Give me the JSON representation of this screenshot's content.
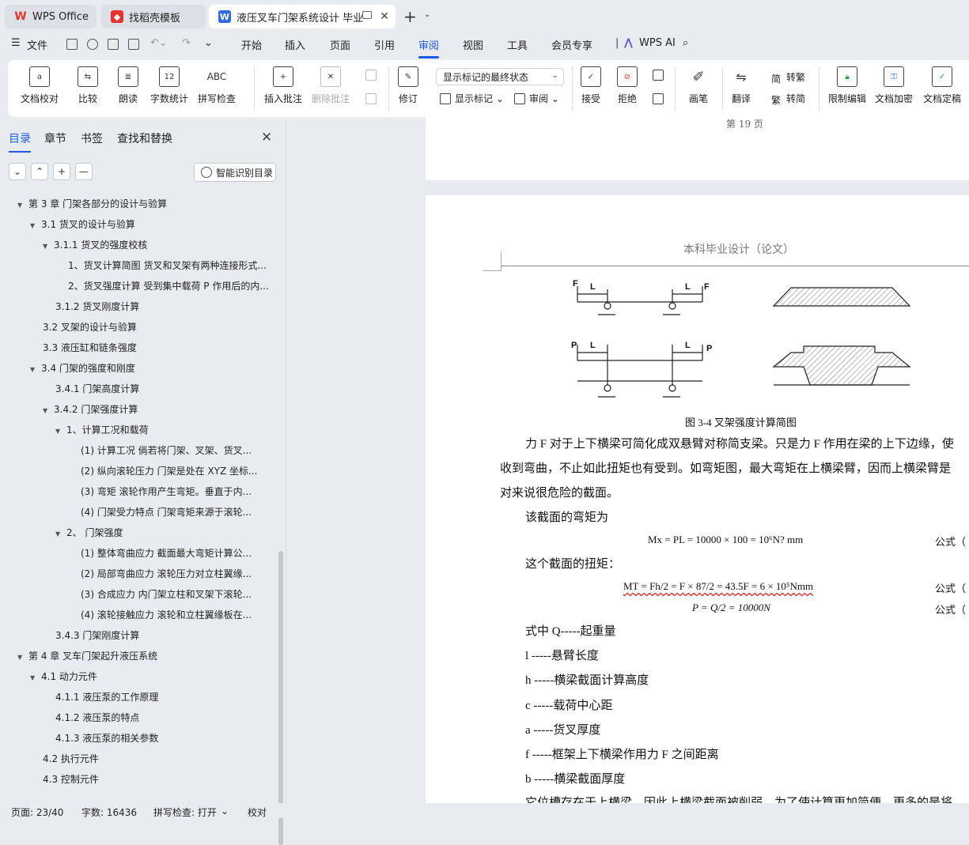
{
  "tabs": [
    {
      "label": "WPS Office",
      "icon": "wps-logo-icon"
    },
    {
      "label": "找稻壳模板",
      "icon": "docer-icon"
    },
    {
      "label": "液压叉车门架系统设计 毕业论",
      "icon": "writer-doc-icon"
    }
  ],
  "menu": {
    "file": "文件",
    "items": [
      "开始",
      "插入",
      "页面",
      "引用",
      "审阅",
      "视图",
      "工具",
      "会员专享"
    ],
    "active": "审阅",
    "ai": "WPS AI"
  },
  "ribbon": {
    "doc_check": "文档校对",
    "compare": "比较",
    "read_aloud": "朗读",
    "word_count": "字数统计",
    "spell_check": "拼写检查",
    "insert_comment": "插入批注",
    "delete_comment": "删除批注",
    "track_changes": "修订",
    "markup_mode": "显示标记的最终状态",
    "show_markup": "显示标记",
    "review_pane": "审阅",
    "accept": "接受",
    "reject": "拒绝",
    "pen": "画笔",
    "translate": "翻译",
    "to_traditional": "转繁",
    "to_simplified": "转简",
    "restrict_edit": "限制编辑",
    "encrypt": "文档加密",
    "finalize": "文档定稿",
    "spell_icon_text": "ABC",
    "count_icon_text": "12"
  },
  "panel": {
    "tabs": [
      "目录",
      "章节",
      "书签",
      "查找和替换"
    ],
    "active_tab": "目录",
    "smart_toc": "智能识别目录",
    "toc": [
      {
        "level": 0,
        "text": "第 3 章  门架各部分的设计与验算",
        "expand": true
      },
      {
        "level": 1,
        "text": "3.1  货叉的设计与验算",
        "expand": true
      },
      {
        "level": 2,
        "text": "3.1.1  货叉的强度校核",
        "expand": true
      },
      {
        "level": 3,
        "text": "1、货叉计算简图  货叉和叉架有两种连接形式..."
      },
      {
        "level": 3,
        "text": "2、货叉强度计算  受到集中载荷 P 作用后的内..."
      },
      {
        "level": 2,
        "text": "3.1.2  货叉刚度计算"
      },
      {
        "level": 1,
        "text": "3.2  叉架的设计与验算"
      },
      {
        "level": 1,
        "text": "3.3  液压缸和链条强度"
      },
      {
        "level": 1,
        "text": "3.4  门架的强度和刚度",
        "expand": true
      },
      {
        "level": 2,
        "text": "3.4.1  门架高度计算"
      },
      {
        "level": 2,
        "text": "3.4.2  门架强度计算",
        "expand": true
      },
      {
        "level": 3,
        "text": "1、计算工况和载荷",
        "expand": true
      },
      {
        "level": 4,
        "text": "(1)   计算工况  倘若将门架、叉架、货叉..."
      },
      {
        "level": 4,
        "text": "(2)   纵向滚轮压力  门架是处在 XYZ 坐标..."
      },
      {
        "level": 4,
        "text": "(3)   弯矩  滚轮作用产生弯矩。垂直于内..."
      },
      {
        "level": 4,
        "text": "(4)   门架受力特点  门架弯矩来源于滚轮..."
      },
      {
        "level": 3,
        "text": "2、   门架强度",
        "expand": true
      },
      {
        "level": 4,
        "text": "(1)   整体弯曲应力  截面最大弯矩计算公..."
      },
      {
        "level": 4,
        "text": "(2)   局部弯曲应力  滚轮压力对立柱翼缘..."
      },
      {
        "level": 4,
        "text": "(3)   合成应力  内门架立柱和叉架下滚轮..."
      },
      {
        "level": 4,
        "text": "(4)   滚轮接触应力  滚轮和立柱翼缘板在..."
      },
      {
        "level": 2,
        "text": "3.4.3  门架刚度计算"
      },
      {
        "level": 0,
        "text": "第 4 章  叉车门架起升液压系统",
        "expand": true
      },
      {
        "level": 1,
        "text": "4.1  动力元件",
        "expand": true
      },
      {
        "level": 2,
        "text": "4.1.1  液压泵的工作原理"
      },
      {
        "level": 2,
        "text": "4.1.2  液压泵的特点"
      },
      {
        "level": 2,
        "text": "4.1.3  液压泵的相关参数"
      },
      {
        "level": 1,
        "text": "4.2  执行元件"
      },
      {
        "level": 1,
        "text": "4.3  控制元件"
      }
    ]
  },
  "document": {
    "page_number": "第 19 页",
    "header": "本科毕业设计（论文）",
    "figure_caption": "图 3-4  叉架强度计算简图",
    "figure_labels": {
      "F": "F",
      "L": "L",
      "P": "P"
    },
    "p1": "力 F 对于上下横梁可简化成双悬臂对称简支梁。只是力 F 作用在梁的上下边缘，使",
    "p2": "收到弯曲，不止如此扭矩也有受到。如弯矩图，最大弯矩在上横梁臂，因而上横梁臂是",
    "p3": "对来说很危险的截面。",
    "p4": "该截面的弯矩为",
    "eq1": "Mx = PL = 10000 × 100 =  10⁶N? mm",
    "eq_label": "公式（",
    "p5": "这个截面的扭矩：",
    "eq2": "MT = Fh/2 =  F × 87/2 = 43.5F = 6 × 10⁵Nmm",
    "eq3": "P = Q/2 = 10000N",
    "p6": "式中    Q-----起重量",
    "p7": "l -----悬臂长度",
    "p8": "h -----横梁截面计算高度",
    "p9": "c -----载荷中心距",
    "p10": "a -----货叉厚度",
    "p11": "f -----框架上下横梁作用力 F 之间距离",
    "p12": "b -----横梁截面厚度",
    "p13": "它位槽存在于上横梁，因此上横梁截面被削弱，为了使计算更加简便，更多的是将"
  },
  "status": {
    "page": "页面: 23/40",
    "words": "字数: 16436",
    "spell": "拼写检查: 打开",
    "proof": "校对"
  },
  "colors": {
    "accent": "#1e5ce6",
    "wps_red": "#e8322e",
    "writer_blue": "#2d6ae3"
  }
}
